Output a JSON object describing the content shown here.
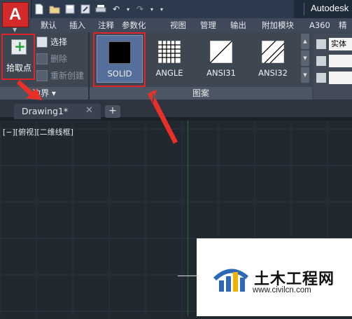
{
  "app": {
    "title": "Autodesk",
    "logo_letter": "A"
  },
  "quick_access_icons": [
    "new-file-icon",
    "open-folder-icon",
    "save-icon",
    "save-as-icon",
    "print-icon",
    "undo-icon",
    "redo-icon",
    "dropdown-icon"
  ],
  "ribbon_tabs": [
    "默认",
    "插入",
    "注释",
    "参数化",
    "视图",
    "管理",
    "输出",
    "附加模块",
    "A360",
    "精"
  ],
  "boundary_panel": {
    "pick_point_label": "拾取点",
    "select_label": "选择",
    "remove_label": "删除",
    "recreate_label": "重新创建",
    "footer": "边界 ▾"
  },
  "pattern_panel": {
    "patterns": [
      {
        "label": "SOLID",
        "selected": true
      },
      {
        "label": "ANGLE",
        "selected": false
      },
      {
        "label": "ANSI31",
        "selected": false
      },
      {
        "label": "ANSI32",
        "selected": false
      }
    ],
    "footer": "图案"
  },
  "properties_panel": {
    "type_value": "实体"
  },
  "document_tab": {
    "name": "Drawing1*",
    "close": "✕",
    "new_tab": "+"
  },
  "viewport_label": "[−][俯视][二维线框]",
  "watermark": {
    "brand": "土木工程网",
    "url": "www.civilcn.com"
  },
  "colors": {
    "highlight_box": "#e0242a",
    "selected_pattern": "#556e9a",
    "canvas": "#212830"
  }
}
